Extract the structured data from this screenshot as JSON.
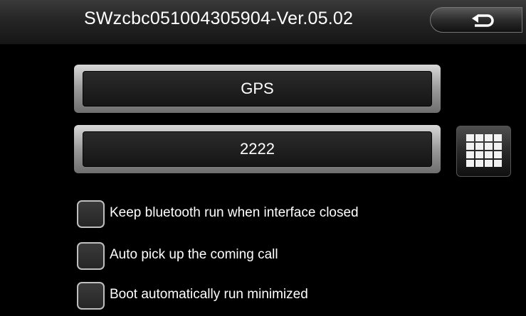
{
  "header": {
    "title": "SWzcbc051004305904-Ver.05.02",
    "back_button_icon": "back-arrow-icon"
  },
  "fields": {
    "device_name": "GPS",
    "pin_code": "2222"
  },
  "keypad_button": {
    "icon": "keypad-grid-icon"
  },
  "options": [
    {
      "label": "Keep bluetooth run when interface closed",
      "checked": false
    },
    {
      "label": "Auto pick up the coming call",
      "checked": false
    },
    {
      "label": "Boot automatically run minimized",
      "checked": false
    }
  ]
}
